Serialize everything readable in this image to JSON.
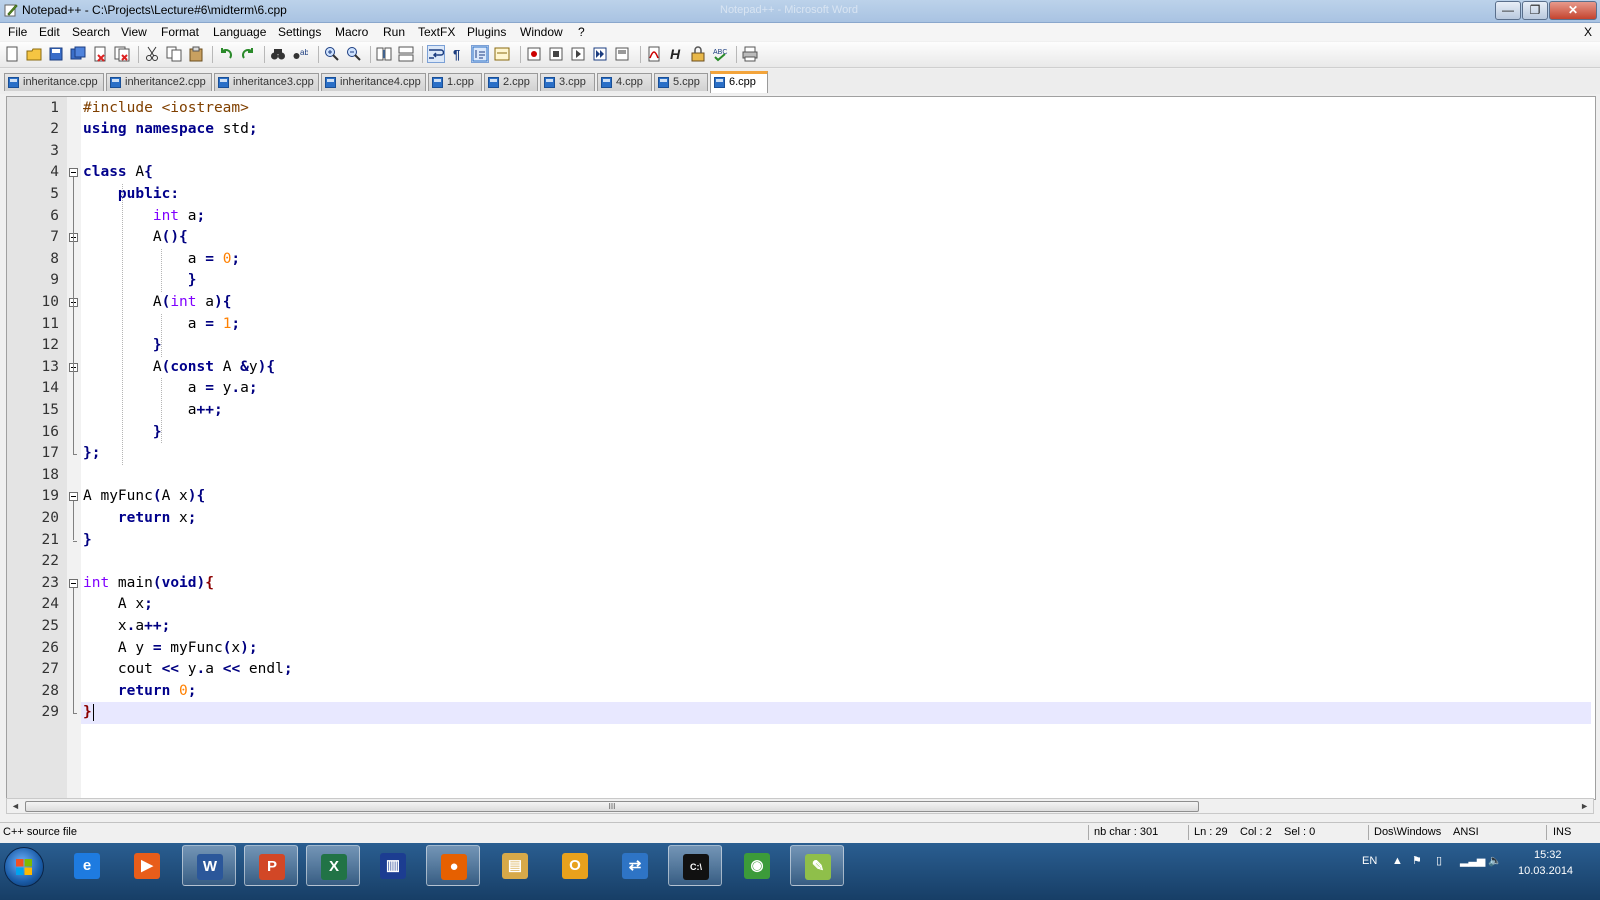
{
  "window": {
    "title": "Notepad++ - C:\\Projects\\Lecture#6\\midterm\\6.cpp",
    "ghost_title": "Notepad++ - Microsoft Word",
    "minimize": "—",
    "maximize": "❐",
    "close": "✕"
  },
  "menu": {
    "items": [
      "File",
      "Edit",
      "Search",
      "View",
      "Format",
      "Language",
      "Settings",
      "Macro",
      "Run",
      "TextFX",
      "Plugins",
      "Window",
      "?"
    ],
    "close_doc": "X"
  },
  "toolbar": {
    "icons": [
      "new-file-icon",
      "open-file-icon",
      "save-icon",
      "save-all-icon",
      "close-icon",
      "close-all-icon",
      "cut-icon",
      "copy-icon",
      "paste-icon",
      "undo-icon",
      "redo-icon",
      "find-icon",
      "replace-icon",
      "zoom-in-icon",
      "zoom-out-icon",
      "sync-vertical-icon",
      "sync-horizontal-icon",
      "word-wrap-icon",
      "show-all-chars-icon",
      "indent-guide-icon",
      "user-lang-icon",
      "record-macro-icon",
      "stop-macro-icon",
      "play-macro-icon",
      "run-macro-multiple-icon",
      "save-macro-icon",
      "pdf-icon",
      "html-tag-icon",
      "lock-icon",
      "spellcheck-icon",
      "print-icon"
    ]
  },
  "tabs": [
    {
      "label": "inheritance.cpp",
      "active": false
    },
    {
      "label": "inheritance2.cpp",
      "active": false
    },
    {
      "label": "inheritance3.cpp",
      "active": false
    },
    {
      "label": "inheritance4.cpp",
      "active": false
    },
    {
      "label": "1.cpp",
      "active": false
    },
    {
      "label": "2.cpp",
      "active": false
    },
    {
      "label": "3.cpp",
      "active": false
    },
    {
      "label": "4.cpp",
      "active": false
    },
    {
      "label": "5.cpp",
      "active": false
    },
    {
      "label": "6.cpp",
      "active": true
    }
  ],
  "code": [
    "#include <iostream>",
    "using namespace std;",
    "",
    "class A{",
    "    public:",
    "        int a;",
    "        A(){",
    "            a = 0;",
    "            }",
    "        A(int a){",
    "            a = 1;",
    "        }",
    "        A(const A &y){",
    "            a = y.a;",
    "            a++;",
    "        }",
    "};",
    "",
    "A myFunc(A x){",
    "    return x;",
    "}",
    "",
    "int main(void){",
    "    A x;",
    "    x.a++;",
    "    A y = myFunc(x);",
    "    cout << y.a << endl;",
    "    return 0;",
    "}"
  ],
  "current_line": 29,
  "scrollbar": {
    "grip": "III",
    "left_arrow": "◄",
    "right_arrow": "►"
  },
  "status": {
    "file_type": "C++ source file",
    "nb_char": "nb char : 301",
    "ln": "Ln : 29",
    "col": "Col : 2",
    "sel": "Sel : 0",
    "eol": "Dos\\Windows",
    "encoding": "ANSI",
    "mode": "INS"
  },
  "taskbar": {
    "apps": [
      {
        "name": "internet-explorer-icon",
        "label": "e",
        "color": "#1e7be0",
        "active": false
      },
      {
        "name": "media-player-icon",
        "label": "▶",
        "color": "#e85d1a",
        "active": false
      },
      {
        "name": "word-icon",
        "label": "W",
        "color": "#2b579a",
        "active": true
      },
      {
        "name": "powerpoint-icon",
        "label": "P",
        "color": "#d24726",
        "active": true
      },
      {
        "name": "excel-icon",
        "label": "X",
        "color": "#217346",
        "active": true
      },
      {
        "name": "visual-studio-icon",
        "label": "▥",
        "color": "#1c3d91",
        "active": false
      },
      {
        "name": "firefox-icon",
        "label": "●",
        "color": "#e66000",
        "active": true
      },
      {
        "name": "file-explorer-icon",
        "label": "▤",
        "color": "#d7a949",
        "active": false
      },
      {
        "name": "outlook-icon",
        "label": "O",
        "color": "#e8a11c",
        "active": false
      },
      {
        "name": "remote-desktop-icon",
        "label": "⇄",
        "color": "#2e74c5",
        "active": false
      },
      {
        "name": "command-prompt-icon",
        "label": "C:\\",
        "color": "#111111",
        "active": true
      },
      {
        "name": "chrome-icon",
        "label": "◉",
        "color": "#3c9b3a",
        "active": false
      },
      {
        "name": "notepadpp-icon",
        "label": "✎",
        "color": "#8fbf4a",
        "active": true
      }
    ],
    "language": "EN",
    "time": "15:32",
    "date": "10.03.2014"
  }
}
